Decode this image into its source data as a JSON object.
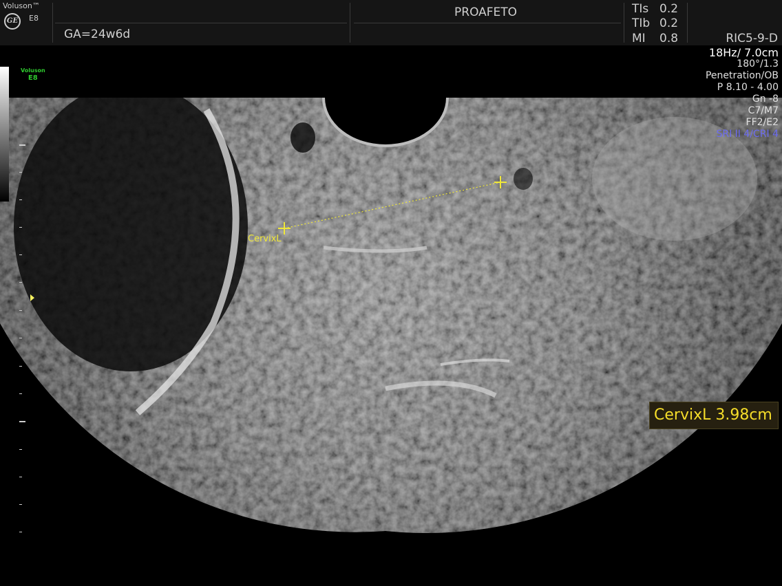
{
  "header": {
    "brand": "Voluson™",
    "model": "E8",
    "logo_text": "GE",
    "gestational_age": "GA=24w6d",
    "patient_name": "PROAFETO",
    "safety": [
      {
        "label": "TIs",
        "value": "0.2"
      },
      {
        "label": "TIb",
        "value": "0.2"
      },
      {
        "label": "MI",
        "value": "0.8"
      }
    ],
    "probe": "RIC5-9-D"
  },
  "params": {
    "frame_depth": "18Hz/ 7.0cm",
    "angle": "180°/1.3",
    "preset": "Penetration/OB",
    "power": "P 8.10 - 4.00",
    "gain": "Gn -8",
    "maps": "C7/M7",
    "filters": "FF2/E2",
    "sri": "SRI II 4/CRI 4"
  },
  "side": {
    "mini_logo_line1": "Voluson",
    "mini_logo_line2": "E8"
  },
  "measurement": {
    "caliper_label": "CervixL",
    "result": "CervixL 3.98cm",
    "value_cm": 3.98
  },
  "colors": {
    "caliper": "#f0e839",
    "result_text": "#f5dd2a",
    "sri_text": "#6c6cf0",
    "logo_green": "#2ec92e"
  }
}
